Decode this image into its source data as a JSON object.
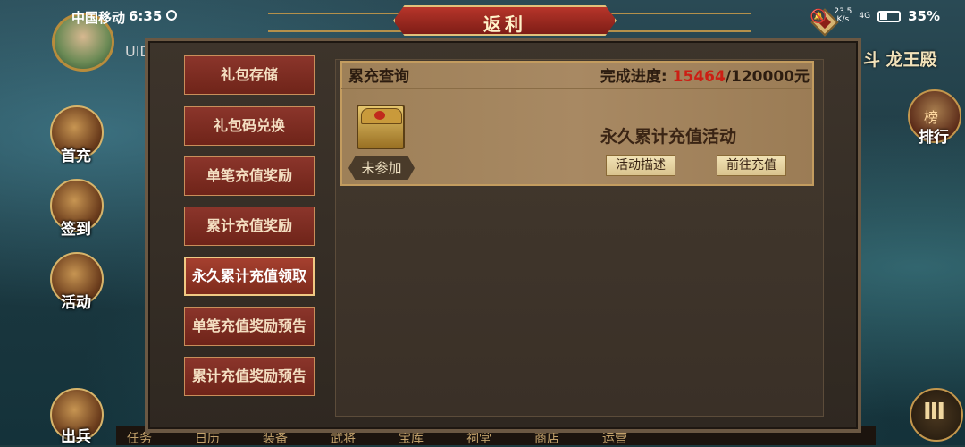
{
  "status_bar": {
    "carrier": "中国移动",
    "time": "6:35",
    "net_speed_value": "23.5",
    "net_speed_unit": "K/s",
    "network": "4G",
    "battery": "35%"
  },
  "hud": {
    "uid_label": "UID",
    "right_title": "斗 龙王殿",
    "right_button_glyph": "榜",
    "right_button_label": "排行",
    "side_buttons": [
      "首充",
      "签到",
      "活动",
      "出兵"
    ],
    "menu_icon": "III",
    "bottom_tabs": [
      "任务",
      "日历",
      "装备",
      "武将",
      "宝库",
      "祠堂",
      "商店",
      "运营"
    ]
  },
  "panel": {
    "title": "返利",
    "menu_items": [
      {
        "label": "礼包存储",
        "active": false
      },
      {
        "label": "礼包码兑换",
        "active": false
      },
      {
        "label": "单笔充值奖励",
        "active": false
      },
      {
        "label": "累计充值奖励",
        "active": false
      },
      {
        "label": "永久累计充值领取",
        "active": true
      },
      {
        "label": "单笔充值奖励预告",
        "active": false
      },
      {
        "label": "累计充值奖励预告",
        "active": false
      }
    ]
  },
  "card": {
    "title": "累充查询",
    "progress_label": "完成进度:",
    "progress_current": "15464",
    "progress_total": "/120000元",
    "status_tag": "未参加",
    "activity_name": "永久累计充值活动",
    "desc_button": "活动描述",
    "recharge_button": "前往充值"
  }
}
